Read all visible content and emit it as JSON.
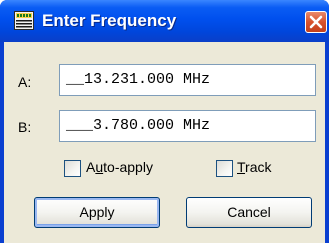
{
  "window": {
    "title": "Enter Frequency",
    "close_icon": "close-icon",
    "app_icon": "frequency-app-icon"
  },
  "fields": {
    "a": {
      "label": "A:",
      "value": "__13.231.000 MHz"
    },
    "b": {
      "label": "B:",
      "value": "___3.780.000 MHz"
    }
  },
  "options": {
    "auto_apply": {
      "label_before": "A",
      "label_underline": "u",
      "label_after": "to-apply",
      "checked": false
    },
    "track": {
      "label_before": "",
      "label_underline": "T",
      "label_after": "rack",
      "checked": false
    }
  },
  "buttons": {
    "apply": "Apply",
    "cancel": "Cancel"
  },
  "colors": {
    "titlebar": "#0050ee",
    "client_bg": "#ece9d8",
    "close_button": "#d8532e",
    "field_border": "#7f9db9"
  }
}
